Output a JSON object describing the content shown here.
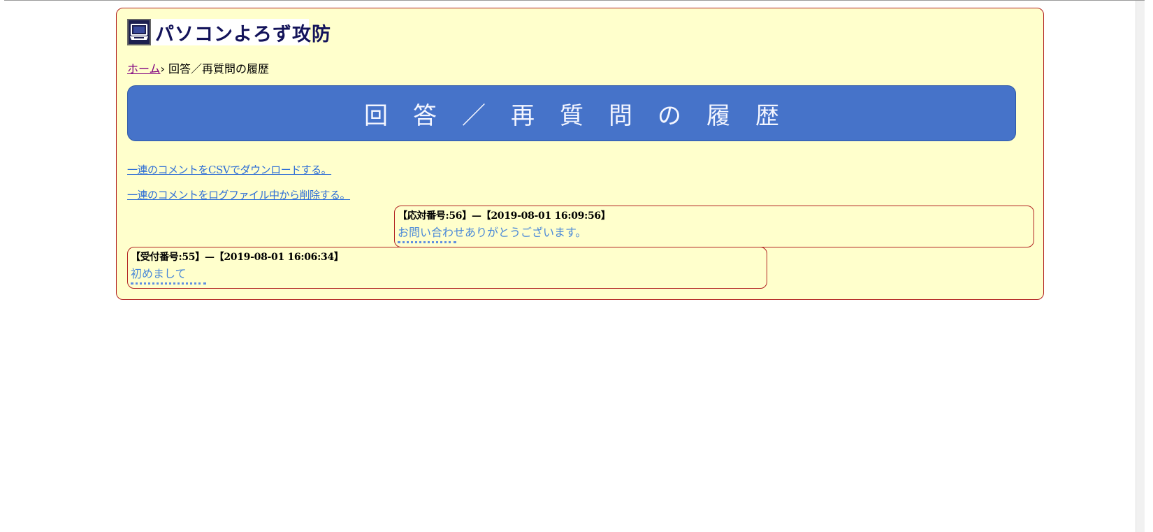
{
  "header": {
    "logo_text": "パソコンよろず攻防",
    "logo_icon": "computer-icon"
  },
  "breadcrumb": {
    "home_label": "ホーム",
    "separator": "›",
    "current": "回答／再質問の履歴"
  },
  "banner": {
    "title": "回答／再質問の履歴"
  },
  "actions": {
    "download_csv": "一連のコメントをCSVでダウンロードする。",
    "delete_from_log": "一連のコメントをログファイル中から削除する。"
  },
  "comments": [
    {
      "header": "【応対番号:56】—【2019-08-01 16:09:56】",
      "body": "お問い合わせありがとうございます。",
      "dots": "··········"
    },
    {
      "header": "【受付番号:55】—【2019-08-01 16:06:34】",
      "body": "初めまして",
      "dots": "·············"
    }
  ],
  "colors": {
    "container_bg": "#ffffcc",
    "container_border": "#b22222",
    "banner_bg": "#4673c9",
    "link": "#2e6ed6",
    "visited_link": "#800080",
    "comment_text": "#4a88d8"
  }
}
